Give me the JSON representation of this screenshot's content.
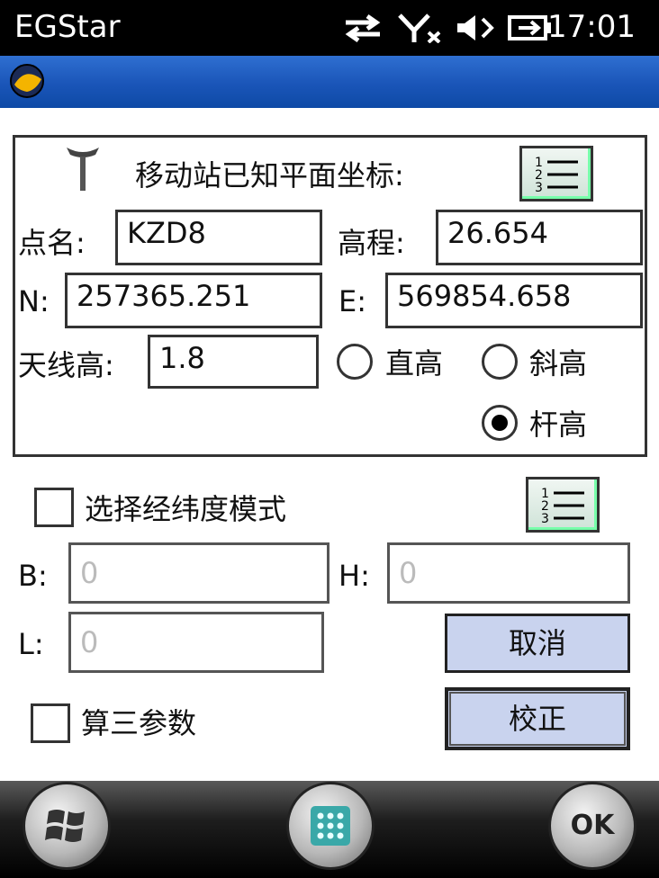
{
  "status_bar": {
    "app_title": "EGStar",
    "time": "17:01",
    "icons": [
      "sync-arrows-icon",
      "no-signal-icon",
      "volume-icon",
      "battery-charging-icon"
    ]
  },
  "known_coords": {
    "heading": "移动站已知平面坐标:",
    "point_name_label": "点名:",
    "point_name_value": "KZD8",
    "elevation_label": "高程:",
    "elevation_value": "26.654",
    "n_label": "N:",
    "n_value": "257365.251",
    "e_label": "E:",
    "e_value": "569854.658",
    "antenna_label": "天线高:",
    "antenna_value": "1.8",
    "measure_options": [
      {
        "label": "直高",
        "selected": false
      },
      {
        "label": "斜高",
        "selected": false
      },
      {
        "label": "杆高",
        "selected": true
      }
    ]
  },
  "latlon": {
    "mode_label": "选择经纬度模式",
    "mode_checked": false,
    "b_label": "B:",
    "b_value": "0",
    "h_label": "H:",
    "h_value": "0",
    "l_label": "L:",
    "l_value": "0"
  },
  "three_param": {
    "label": "算三参数",
    "checked": false
  },
  "buttons": {
    "cancel": "取消",
    "calibrate": "校正"
  },
  "softkeys": {
    "ok": "OK"
  },
  "colors": {
    "title_bar": "#1a55b8",
    "command_button": "#c9d3ee",
    "status_bar": "#000000"
  }
}
